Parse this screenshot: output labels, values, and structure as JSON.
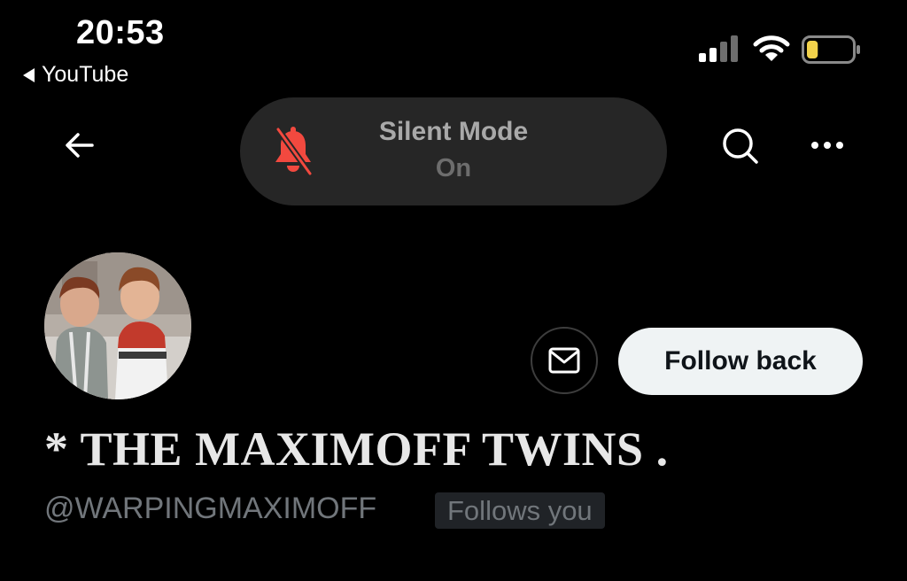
{
  "status_bar": {
    "time": "20:53",
    "back_app_label": "YouTube",
    "signal_icon": "cellular-signal-icon",
    "wifi_icon": "wifi-icon",
    "battery_icon": "battery-low-icon",
    "battery_level": 0.25,
    "battery_color": "#f2d24b"
  },
  "nav": {
    "back_icon": "arrow-left-icon",
    "search_icon": "search-icon",
    "more_icon": "more-dots-icon"
  },
  "silent_mode": {
    "title": "Silent Mode",
    "state": "On",
    "icon": "bell-slash-icon",
    "icon_color": "#f2493f"
  },
  "profile": {
    "display_name": "* THE MAXIMOFF TWINS .",
    "handle": "@WARPINGMAXIMOFF",
    "follows_you_label": "Follows you",
    "follow_button_label": "Follow back",
    "message_icon": "envelope-icon"
  }
}
